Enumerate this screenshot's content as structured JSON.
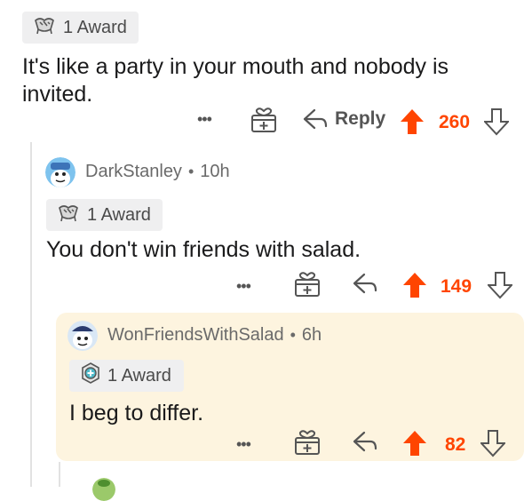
{
  "comment_top": {
    "award_count": "1 Award",
    "award_icon": "silver-award-icon",
    "text": "It's like a party in your mouth and nobody is invited.",
    "more_label": "•••",
    "reply_label": "Reply",
    "score": "260"
  },
  "comment_mid": {
    "username": "DarkStanley",
    "separator": "•",
    "time": "10h",
    "award_count": "1 Award",
    "award_icon": "silver-award-icon",
    "text": "You don't win friends with salad.",
    "more_label": "•••",
    "score": "149"
  },
  "comment_bottom": {
    "username": "WonFriendsWithSalad",
    "separator": "•",
    "time": "6h",
    "award_count": "1 Award",
    "award_icon": "helpful-award-icon",
    "text": "I beg to differ.",
    "more_label": "•••",
    "score": "82",
    "highlight_color": "#fdf4df"
  },
  "colors": {
    "upvote": "#ff4500",
    "text": "#1a1a1b",
    "muted": "#6a6a6a",
    "chip": "#efeff0"
  }
}
